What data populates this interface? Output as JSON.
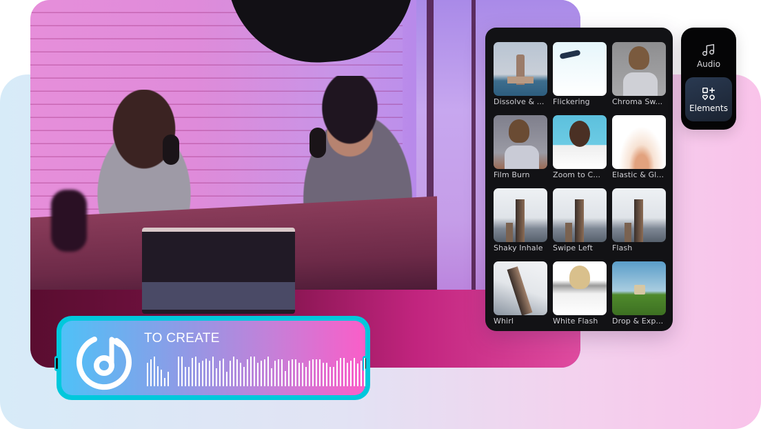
{
  "photo": {
    "description": "podcast-studio-two-hosts"
  },
  "effects_panel": {
    "items": [
      {
        "label": "Dissolve & ...",
        "thumb": "tower"
      },
      {
        "label": "Flickering",
        "thumb": "flicker"
      },
      {
        "label": "Chroma Sw...",
        "thumb": "person-grey"
      },
      {
        "label": "Film Burn",
        "thumb": "filmburn"
      },
      {
        "label": "Zoom to C...",
        "thumb": "zoom"
      },
      {
        "label": "Elastic & Gl...",
        "thumb": "elastic"
      },
      {
        "label": "Shaky Inhale",
        "thumb": "city"
      },
      {
        "label": "Swipe Left",
        "thumb": "city"
      },
      {
        "label": "Flash",
        "thumb": "city"
      },
      {
        "label": "Whirl",
        "thumb": "whirl"
      },
      {
        "label": "White Flash",
        "thumb": "whiteflash"
      },
      {
        "label": "Drop & Exp...",
        "thumb": "drop"
      }
    ]
  },
  "tool_panel": {
    "audio": {
      "label": "Audio",
      "icon": "music-note-icon"
    },
    "elements": {
      "label": "Elements",
      "icon": "elements-icon",
      "active": true
    }
  },
  "audio_card": {
    "title": "TO CREATE",
    "icon": "music-disc-icon",
    "waveform": [
      0.78,
      0.9,
      1.0,
      0.68,
      0.55,
      0.28,
      0.48,
      0.0,
      0.0,
      1.0,
      1.0,
      0.66,
      0.66,
      0.95,
      1.0,
      0.8,
      0.86,
      0.92,
      0.86,
      1.0,
      0.6,
      0.86,
      0.92,
      0.5,
      0.86,
      1.0,
      0.9,
      0.78,
      0.66,
      0.9,
      1.0,
      1.0,
      0.8,
      0.86,
      0.9,
      1.0,
      0.6,
      0.86,
      0.9,
      0.9,
      0.52,
      0.86,
      0.9,
      0.9,
      0.78,
      0.78,
      0.66,
      0.86,
      0.9,
      0.9,
      0.9,
      0.8,
      0.8,
      0.66,
      0.66,
      0.86,
      0.96,
      0.96,
      0.8,
      0.86,
      0.96,
      0.76,
      0.86,
      0.96
    ],
    "colors": {
      "frame": "#00c8dc",
      "gradient_start": "#4fc1f7",
      "gradient_end": "#fa5ec8"
    }
  }
}
